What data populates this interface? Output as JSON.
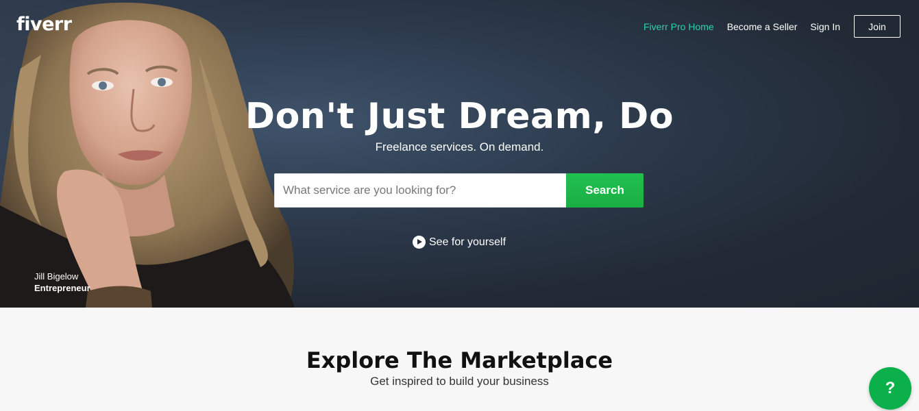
{
  "header": {
    "logo": "fiverr",
    "nav": {
      "pro_home": "Fiverr Pro Home",
      "become_seller": "Become a Seller",
      "sign_in": "Sign In",
      "join": "Join"
    }
  },
  "hero": {
    "headline": "Don't Just Dream, Do",
    "subheadline": "Freelance services. On demand.",
    "search": {
      "placeholder": "What service are you looking for?",
      "value": "",
      "button_label": "Search"
    },
    "video_link": "See for yourself",
    "person": {
      "name": "Jill Bigelow",
      "role": "Entrepreneur"
    }
  },
  "explore": {
    "title": "Explore The Marketplace",
    "subtitle": "Get inspired to build your business"
  },
  "help_button": {
    "label": "?"
  },
  "colors": {
    "brand_green": "#1dbf73",
    "pro_link": "#2bd2b0",
    "search_button": "#1db949",
    "hero_background": "#222a36",
    "help_button": "#0cb04a"
  }
}
